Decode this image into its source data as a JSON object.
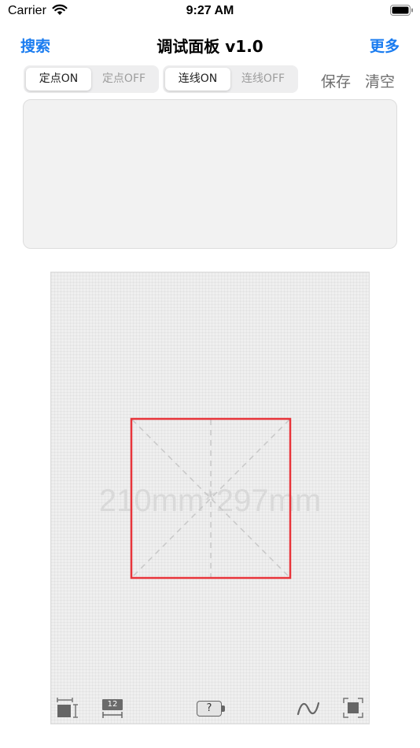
{
  "status_bar": {
    "carrier": "Carrier",
    "time": "9:27 AM",
    "wifi_icon": "wifi-icon",
    "battery_icon": "battery-icon"
  },
  "nav": {
    "left_label": "搜索",
    "title": "调试面板 v1.0",
    "right_label": "更多",
    "accent_color": "#1a7cf0"
  },
  "controls": {
    "point_segment": {
      "options": [
        "定点ON",
        "定点OFF"
      ],
      "selected": "定点ON"
    },
    "line_segment": {
      "options": [
        "连线ON",
        "连线OFF"
      ],
      "selected": "连线ON"
    },
    "save_label": "保存",
    "clear_label": "清空"
  },
  "log_box": {
    "text": ""
  },
  "canvas": {
    "paper_label": "210mm*297mm",
    "frame_color": "#e8343a",
    "guide_color": "#c8c8c8"
  },
  "toolbar": {
    "tools": [
      {
        "name": "size-adjust-icon"
      },
      {
        "name": "font-size-icon",
        "label": "12"
      },
      {
        "name": "help-battery-icon",
        "label": "?"
      },
      {
        "name": "curve-icon"
      },
      {
        "name": "fit-frame-icon"
      }
    ]
  }
}
